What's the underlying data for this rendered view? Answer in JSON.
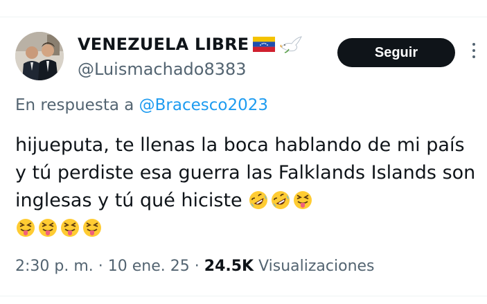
{
  "author": {
    "display_name": "VENEZUELA LIBRE",
    "handle": "@Luismachado8383",
    "name_icons": [
      "venezuela-flag-icon",
      "dove-icon"
    ]
  },
  "actions": {
    "follow_label": "Seguir",
    "more_icon": "more-vertical-icon"
  },
  "reply": {
    "prefix": "En respuesta a",
    "mention": "@Bracesco2023"
  },
  "tweet": {
    "text": "hijueputa, te llenas la boca hablando de mi país y tú perdiste esa guerra las Falklands Islands son inglesas y tú qué hiciste",
    "emojis": [
      "rofl-emoji",
      "rofl-emoji",
      "squinting-tongue-emoji",
      "squinting-tongue-emoji",
      "squinting-tongue-emoji",
      "squinting-tongue-emoji",
      "squinting-tongue-emoji"
    ]
  },
  "meta": {
    "time": "2:30 p. m.",
    "separator": "·",
    "date": "10 ene. 25",
    "views_count": "24.5K",
    "views_label": "Visualizaciones"
  },
  "colors": {
    "text": "#0f1419",
    "secondary": "#536471",
    "link": "#1d9bf0",
    "button_bg": "#0f1419"
  }
}
